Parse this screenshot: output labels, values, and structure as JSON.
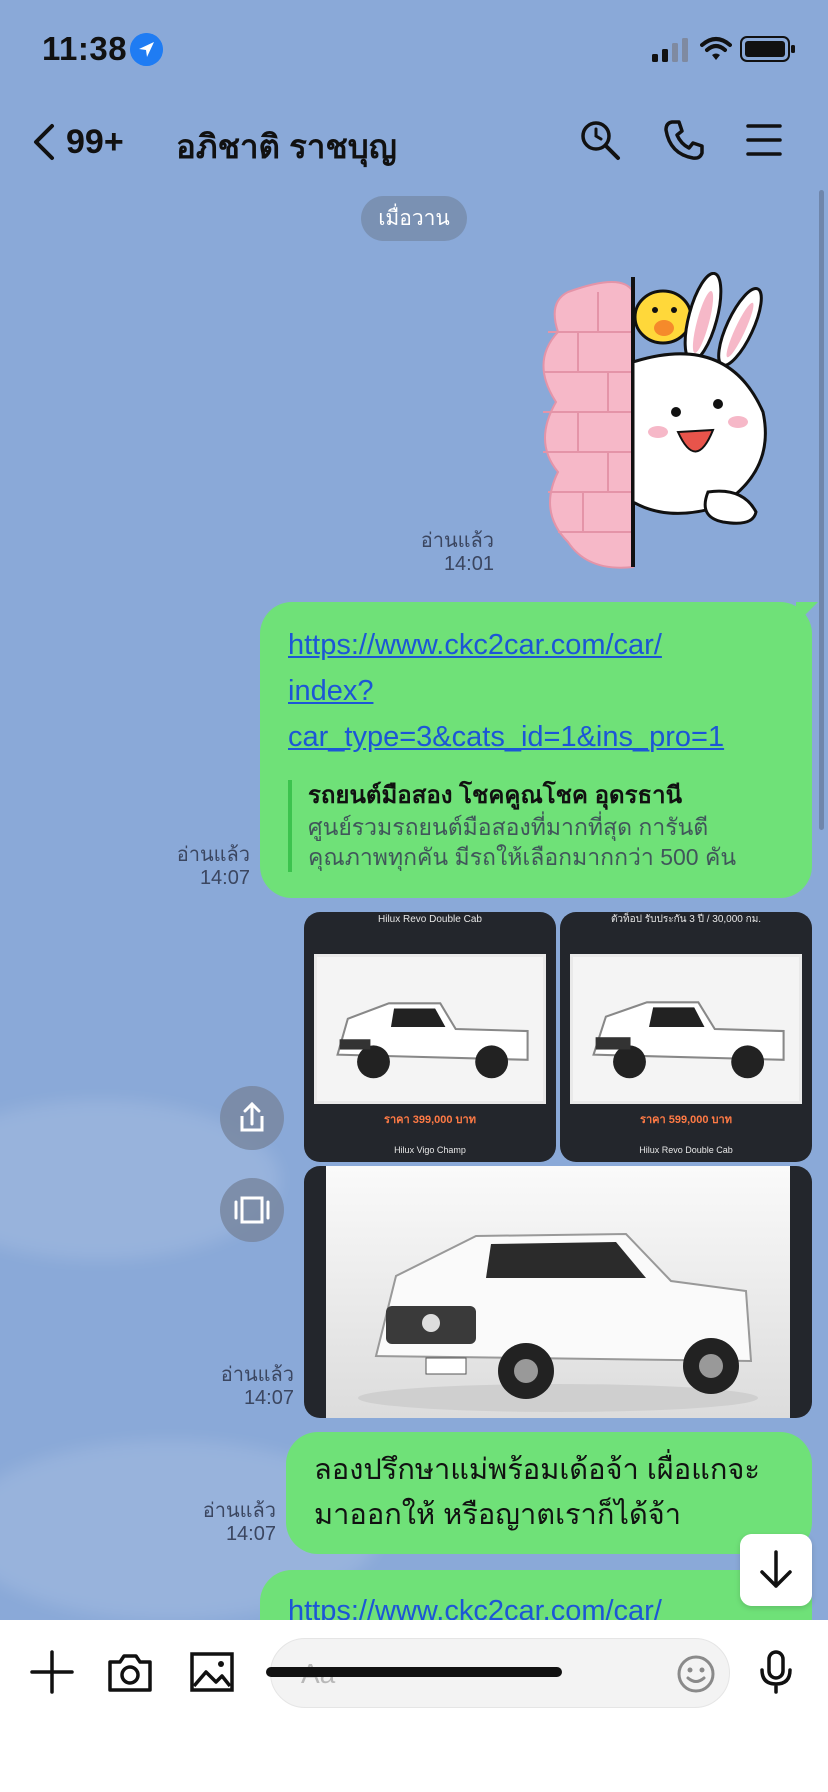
{
  "status_bar": {
    "time": "11:38"
  },
  "header": {
    "unread_count": "99+",
    "chat_title": "อภิชาติ ราชบุญ"
  },
  "chat": {
    "date_divider": "เมื่อวาน",
    "messages": [
      {
        "type": "sticker",
        "read_label": "อ่านแล้ว",
        "time": "14:01"
      },
      {
        "type": "link",
        "url": "https://www.ckc2car.com/car/index?car_type=3&cats_id=1&ins_pro=1",
        "url_lines": [
          "https://www.ckc2car.com/car/",
          "index?",
          "car_type=3&cats_id=1&ins_pro=1"
        ],
        "preview_title": "รถยนต์มือสอง โชคคูณโชค อุดรธานี",
        "preview_desc_lines": [
          "ศูนย์รวมรถยนต์มือสองที่มากที่สุด การันตี",
          "คุณภาพทุกคัน มีรถให้เลือกมากกว่า 500 คัน"
        ],
        "read_label": "อ่านแล้ว",
        "time": "14:07"
      },
      {
        "type": "images",
        "tiles": [
          {
            "header": "Hilux Revo Double Cab",
            "price": "ราคา 399,000 บาท",
            "footer": "Hilux Vigo Champ"
          },
          {
            "header": "ตัวท็อป รับประกัน 3 ปี / 30,000 กม.",
            "price": "ราคา 599,000 บาท",
            "footer": "Hilux Revo Double Cab"
          }
        ],
        "read_label": "อ่านแล้ว",
        "time": "14:07"
      },
      {
        "type": "text",
        "lines": [
          "ลองปรึกษาแม่พร้อมเด้อจ้า เผื่อแกจะ",
          "มาออกให้ หรือญาตเราก็ได้จ้า"
        ],
        "read_label": "อ่านแล้ว",
        "time": "14:07"
      },
      {
        "type": "link",
        "url_lines": [
          "https://www.ckc2car.com/car/"
        ]
      }
    ]
  },
  "input": {
    "placeholder": "Aa"
  },
  "colors": {
    "background": "#8aa9d8",
    "bubble": "#6fe178",
    "link": "#1c56d6"
  }
}
